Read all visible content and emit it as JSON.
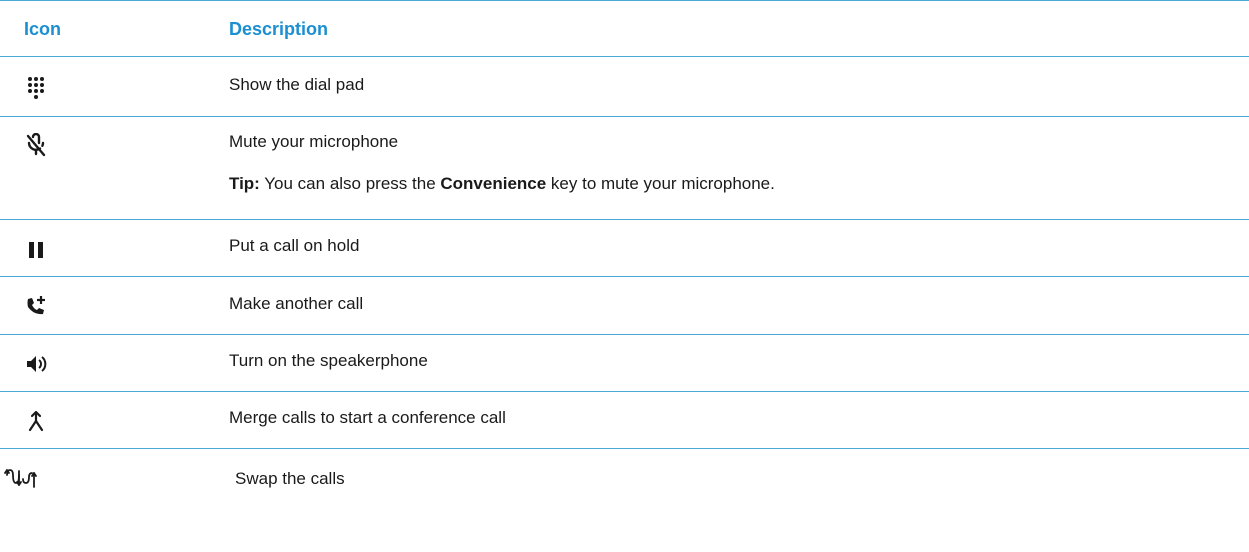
{
  "header": {
    "icon_col": "Icon",
    "description_col": "Description"
  },
  "rows": [
    {
      "icon": "dialpad-icon",
      "description": "Show the dial pad"
    },
    {
      "icon": "mic-off-icon",
      "description": "Mute your microphone",
      "tip_label": "Tip:",
      "tip_text_1": " You can also press the ",
      "tip_key": "Convenience",
      "tip_text_2": " key to mute your microphone."
    },
    {
      "icon": "pause-icon",
      "description": "Put a call on hold"
    },
    {
      "icon": "add-call-icon",
      "description": "Make another call"
    },
    {
      "icon": "speaker-icon",
      "description": "Turn on the speakerphone"
    },
    {
      "icon": "merge-icon",
      "description": "Merge calls to start a conference call"
    },
    {
      "icon": "swap-calls-icon",
      "description": "Swap the calls"
    }
  ],
  "colors": {
    "header_text": "#1b8fd1",
    "rule": "#4aa8d8",
    "body_text": "#1a1a1a"
  }
}
